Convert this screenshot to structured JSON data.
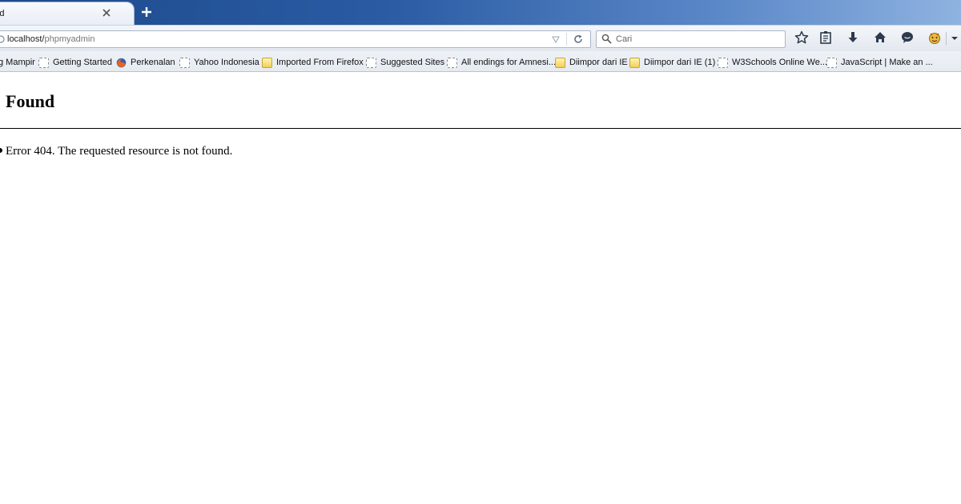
{
  "window": {
    "tab_title": "ound",
    "tab_close_icon": "close-icon",
    "new_tab_icon": "plus-icon"
  },
  "navigation": {
    "url_host": "localhost/",
    "url_path": "phpmyadmin",
    "site_icon": "globe-icon",
    "search_placeholder": "Cari",
    "icons": [
      "star-icon",
      "bookmarks-list-icon",
      "download-arrow-icon",
      "home-icon",
      "chat-bubble-icon",
      "addon-face-icon",
      "chevron-down-icon"
    ]
  },
  "bookmarks": [
    {
      "label": "g Mampir",
      "icon": "none"
    },
    {
      "label": "Getting Started",
      "icon": "page-icon"
    },
    {
      "label": "Perkenalan",
      "icon": "firefox-icon"
    },
    {
      "label": "Yahoo Indonesia",
      "icon": "page-icon"
    },
    {
      "label": "Imported From Firefox",
      "icon": "folder-icon"
    },
    {
      "label": "Suggested Sites",
      "icon": "page-icon"
    },
    {
      "label": "All endings for Amnesi...",
      "icon": "page-icon"
    },
    {
      "label": "Diimpor dari IE",
      "icon": "folder-icon"
    },
    {
      "label": "Diimpor dari IE (1)",
      "icon": "folder-icon"
    },
    {
      "label": "W3Schools Online We...",
      "icon": "page-icon"
    },
    {
      "label": "JavaScript | Make an ...",
      "icon": "page-icon"
    }
  ],
  "page": {
    "heading": "Found",
    "error_message": "Error 404. The requested resource is not found."
  }
}
